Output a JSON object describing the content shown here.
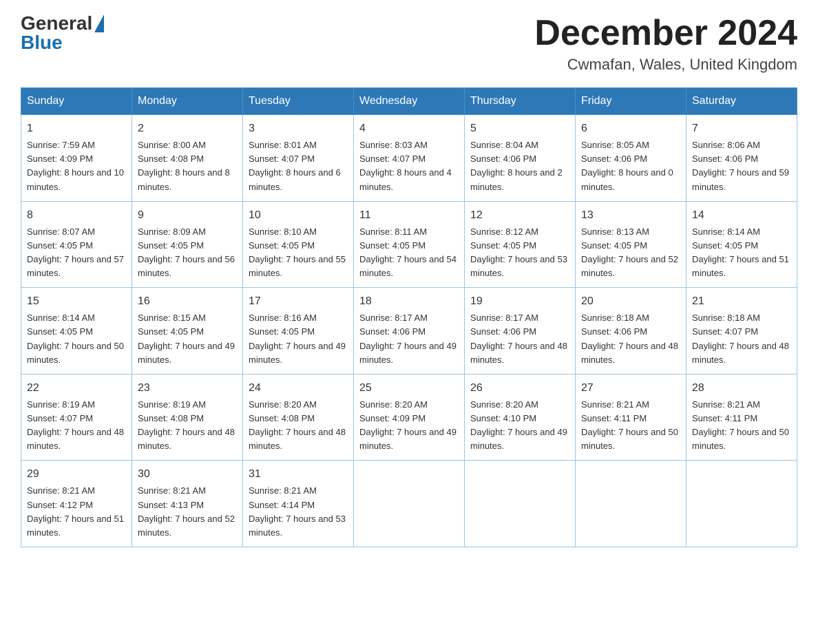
{
  "logo": {
    "general": "General",
    "blue": "Blue"
  },
  "title": "December 2024",
  "location": "Cwmafan, Wales, United Kingdom",
  "weekdays": [
    "Sunday",
    "Monday",
    "Tuesday",
    "Wednesday",
    "Thursday",
    "Friday",
    "Saturday"
  ],
  "weeks": [
    [
      {
        "day": "1",
        "sunrise": "7:59 AM",
        "sunset": "4:09 PM",
        "daylight": "8 hours and 10 minutes."
      },
      {
        "day": "2",
        "sunrise": "8:00 AM",
        "sunset": "4:08 PM",
        "daylight": "8 hours and 8 minutes."
      },
      {
        "day": "3",
        "sunrise": "8:01 AM",
        "sunset": "4:07 PM",
        "daylight": "8 hours and 6 minutes."
      },
      {
        "day": "4",
        "sunrise": "8:03 AM",
        "sunset": "4:07 PM",
        "daylight": "8 hours and 4 minutes."
      },
      {
        "day": "5",
        "sunrise": "8:04 AM",
        "sunset": "4:06 PM",
        "daylight": "8 hours and 2 minutes."
      },
      {
        "day": "6",
        "sunrise": "8:05 AM",
        "sunset": "4:06 PM",
        "daylight": "8 hours and 0 minutes."
      },
      {
        "day": "7",
        "sunrise": "8:06 AM",
        "sunset": "4:06 PM",
        "daylight": "7 hours and 59 minutes."
      }
    ],
    [
      {
        "day": "8",
        "sunrise": "8:07 AM",
        "sunset": "4:05 PM",
        "daylight": "7 hours and 57 minutes."
      },
      {
        "day": "9",
        "sunrise": "8:09 AM",
        "sunset": "4:05 PM",
        "daylight": "7 hours and 56 minutes."
      },
      {
        "day": "10",
        "sunrise": "8:10 AM",
        "sunset": "4:05 PM",
        "daylight": "7 hours and 55 minutes."
      },
      {
        "day": "11",
        "sunrise": "8:11 AM",
        "sunset": "4:05 PM",
        "daylight": "7 hours and 54 minutes."
      },
      {
        "day": "12",
        "sunrise": "8:12 AM",
        "sunset": "4:05 PM",
        "daylight": "7 hours and 53 minutes."
      },
      {
        "day": "13",
        "sunrise": "8:13 AM",
        "sunset": "4:05 PM",
        "daylight": "7 hours and 52 minutes."
      },
      {
        "day": "14",
        "sunrise": "8:14 AM",
        "sunset": "4:05 PM",
        "daylight": "7 hours and 51 minutes."
      }
    ],
    [
      {
        "day": "15",
        "sunrise": "8:14 AM",
        "sunset": "4:05 PM",
        "daylight": "7 hours and 50 minutes."
      },
      {
        "day": "16",
        "sunrise": "8:15 AM",
        "sunset": "4:05 PM",
        "daylight": "7 hours and 49 minutes."
      },
      {
        "day": "17",
        "sunrise": "8:16 AM",
        "sunset": "4:05 PM",
        "daylight": "7 hours and 49 minutes."
      },
      {
        "day": "18",
        "sunrise": "8:17 AM",
        "sunset": "4:06 PM",
        "daylight": "7 hours and 49 minutes."
      },
      {
        "day": "19",
        "sunrise": "8:17 AM",
        "sunset": "4:06 PM",
        "daylight": "7 hours and 48 minutes."
      },
      {
        "day": "20",
        "sunrise": "8:18 AM",
        "sunset": "4:06 PM",
        "daylight": "7 hours and 48 minutes."
      },
      {
        "day": "21",
        "sunrise": "8:18 AM",
        "sunset": "4:07 PM",
        "daylight": "7 hours and 48 minutes."
      }
    ],
    [
      {
        "day": "22",
        "sunrise": "8:19 AM",
        "sunset": "4:07 PM",
        "daylight": "7 hours and 48 minutes."
      },
      {
        "day": "23",
        "sunrise": "8:19 AM",
        "sunset": "4:08 PM",
        "daylight": "7 hours and 48 minutes."
      },
      {
        "day": "24",
        "sunrise": "8:20 AM",
        "sunset": "4:08 PM",
        "daylight": "7 hours and 48 minutes."
      },
      {
        "day": "25",
        "sunrise": "8:20 AM",
        "sunset": "4:09 PM",
        "daylight": "7 hours and 49 minutes."
      },
      {
        "day": "26",
        "sunrise": "8:20 AM",
        "sunset": "4:10 PM",
        "daylight": "7 hours and 49 minutes."
      },
      {
        "day": "27",
        "sunrise": "8:21 AM",
        "sunset": "4:11 PM",
        "daylight": "7 hours and 50 minutes."
      },
      {
        "day": "28",
        "sunrise": "8:21 AM",
        "sunset": "4:11 PM",
        "daylight": "7 hours and 50 minutes."
      }
    ],
    [
      {
        "day": "29",
        "sunrise": "8:21 AM",
        "sunset": "4:12 PM",
        "daylight": "7 hours and 51 minutes."
      },
      {
        "day": "30",
        "sunrise": "8:21 AM",
        "sunset": "4:13 PM",
        "daylight": "7 hours and 52 minutes."
      },
      {
        "day": "31",
        "sunrise": "8:21 AM",
        "sunset": "4:14 PM",
        "daylight": "7 hours and 53 minutes."
      },
      null,
      null,
      null,
      null
    ]
  ],
  "labels": {
    "sunrise": "Sunrise:",
    "sunset": "Sunset:",
    "daylight": "Daylight:"
  }
}
